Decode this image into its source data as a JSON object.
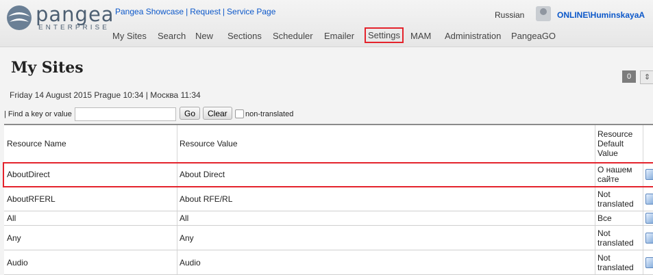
{
  "brand": {
    "name": "pangea",
    "subtitle": "ENTERPRISE"
  },
  "top_links": [
    "Pangea Showcase",
    "Request",
    "Service Page"
  ],
  "nav": [
    "My Sites",
    "Search",
    "New",
    "Sections",
    "Scheduler",
    "Emailer",
    "Settings",
    "MAM",
    "Administration",
    "PangeaGO"
  ],
  "header": {
    "language": "Russian",
    "user": "ONLINE\\HuminskayaA"
  },
  "page": {
    "title": "My Sites",
    "badge_count": "0",
    "dateline": "Friday 14 August 2015 Prague 10:34 | Москва 11:34"
  },
  "filter": {
    "label": "| Find a key or value",
    "go_label": "Go",
    "clear_label": "Clear",
    "non_translated_label": "non-translated"
  },
  "table": {
    "headers": [
      "Resource Name",
      "Resource Value",
      "Resource Default Value"
    ],
    "rows": [
      {
        "name": "AboutDirect",
        "value": "About Direct",
        "default": "О нашем сайте"
      },
      {
        "name": "AboutRFERL",
        "value": "About RFE/RL",
        "default": "Not translated"
      },
      {
        "name": "All",
        "value": "All",
        "default": "Все"
      },
      {
        "name": "Any",
        "value": "Any",
        "default": "Not translated"
      },
      {
        "name": "Audio",
        "value": "Audio",
        "default": "Not translated"
      }
    ]
  },
  "colors": {
    "link": "#0b57c9",
    "highlight": "#e4222b"
  }
}
